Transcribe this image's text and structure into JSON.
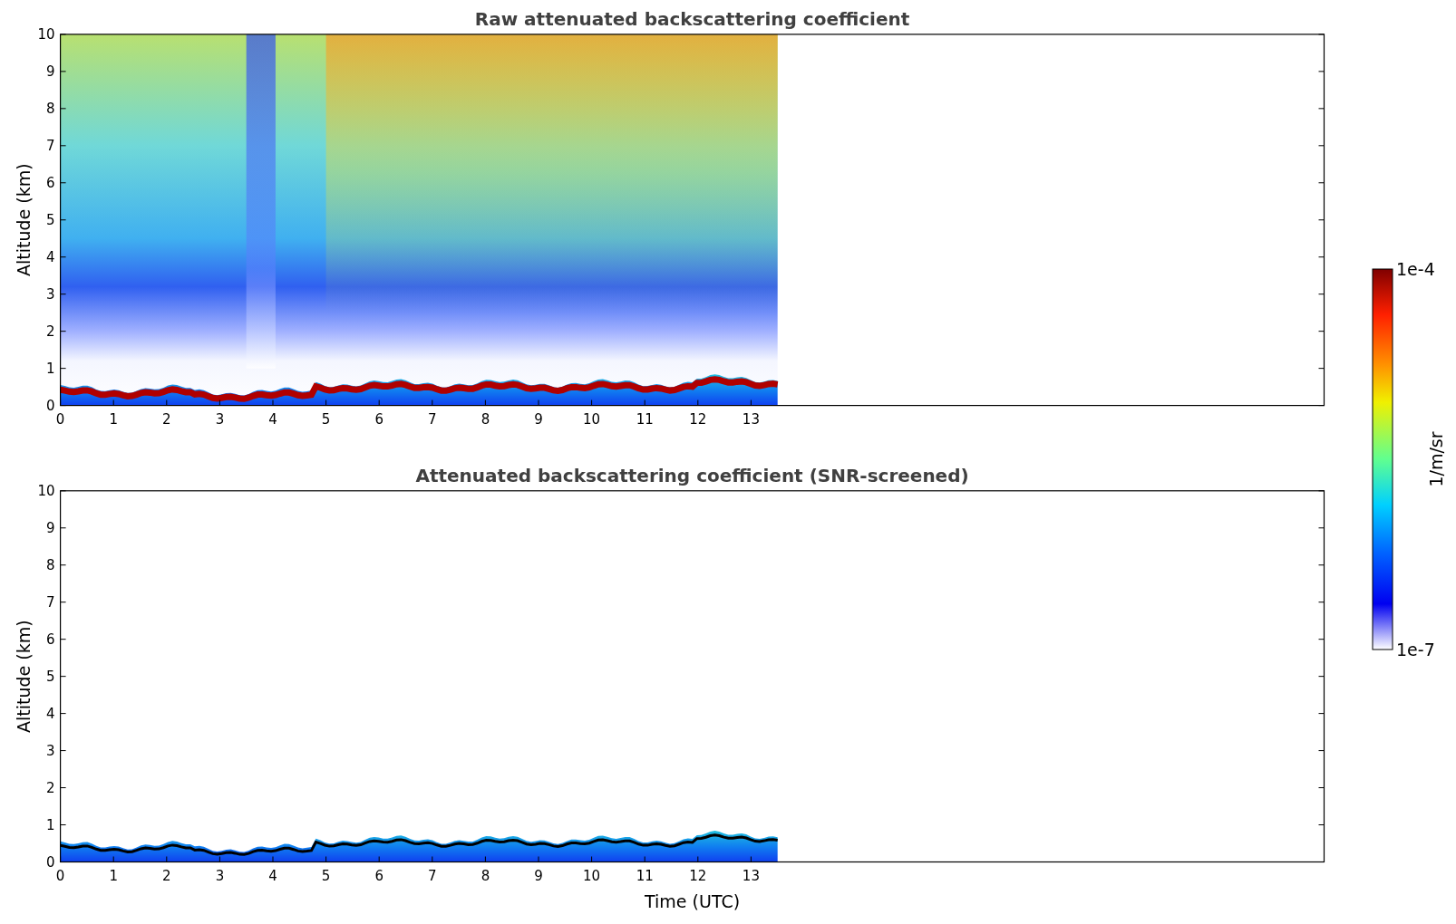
{
  "figure": {
    "panels": [
      {
        "kind": "raw",
        "title": "Raw attenuated backscattering coefficient",
        "ylabel": "Altitude (km)",
        "yticks": [
          "10",
          "9",
          "8",
          "7",
          "6",
          "5",
          "4",
          "3",
          "2",
          "1",
          "0"
        ],
        "xticks": [
          "0",
          "1",
          "2",
          "3",
          "4",
          "5",
          "6",
          "7",
          "8",
          "9",
          "10",
          "11",
          "12",
          "13"
        ]
      },
      {
        "kind": "screened",
        "title": "Attenuated backscattering coefficient (SNR-screened)",
        "ylabel": "Altitude (km)",
        "yticks": [
          "10",
          "9",
          "8",
          "7",
          "6",
          "5",
          "4",
          "3",
          "2",
          "1",
          "0"
        ],
        "xticks": [
          "0",
          "1",
          "2",
          "3",
          "4",
          "5",
          "6",
          "7",
          "8",
          "9",
          "10",
          "11",
          "12",
          "13"
        ],
        "xlabel": "Time (UTC)"
      }
    ],
    "colorbar": {
      "label": "1/m/sr",
      "max_label": "1e-4",
      "min_label": "1e-7"
    }
  }
}
